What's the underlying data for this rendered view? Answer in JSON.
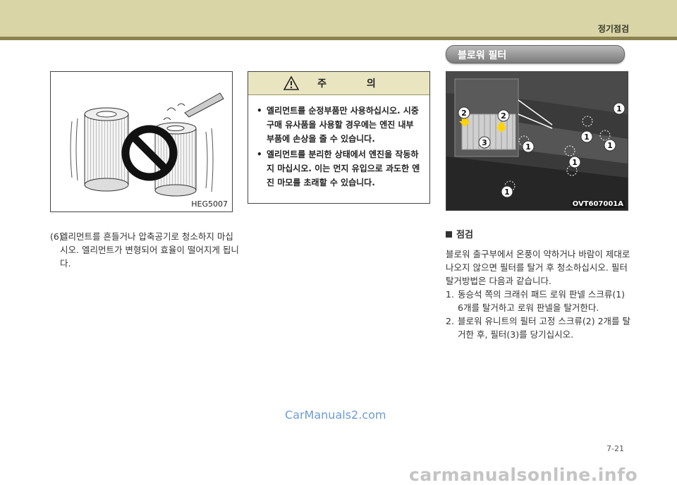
{
  "header": {
    "chapter": "정기점검"
  },
  "figure1": {
    "code": "HEG5007"
  },
  "step6": {
    "num": "(6)",
    "text": "엘리먼트를 흔들거나 압축공기로 청소하지 마십시오. 엘리먼트가 변형되어 효율이 떨어지게 됩니다."
  },
  "caution": {
    "title": "주 의",
    "items": [
      "엘리먼트를 순정부품만 사용하십시오. 시중구매 유사품을 사용할 경우에는 엔진 내부 부품에 손상을 줄 수 있습니다.",
      "엘리먼트를 분리한 상태에서 엔진을 작동하지 마십시오. 이는 먼지 유입으로 과도한 엔진 마모를 초래할 수 있습니다."
    ]
  },
  "section": {
    "title": "블로워 필터"
  },
  "photo": {
    "code": "OVT607001A",
    "callouts": [
      "1",
      "1",
      "1",
      "1",
      "1",
      "1",
      "2",
      "2",
      "3"
    ]
  },
  "inspection": {
    "heading": "점검",
    "intro": "블로워 출구부에서 온풍이 약하거나 바람이 제대로 나오지 않으면 필터를 탈거 후 청소하십시오. 필터 탈거방법은 다음과 같습니다.",
    "steps": [
      {
        "num": "1.",
        "text": "동승석 쪽의 크래쉬 패드 로워 판넬 스크류(1) 6개를 탈거하고 로워 판넬을 탈거한다."
      },
      {
        "num": "2.",
        "text": "블로워 유니트의 필터 고정 스크류(2) 2개를 탈거한 후, 필터(3)를 당기십시오."
      }
    ]
  },
  "watermark": "CarManuals2.com",
  "page_number": "7-21",
  "footer_watermark": "carmanualsonline.info"
}
